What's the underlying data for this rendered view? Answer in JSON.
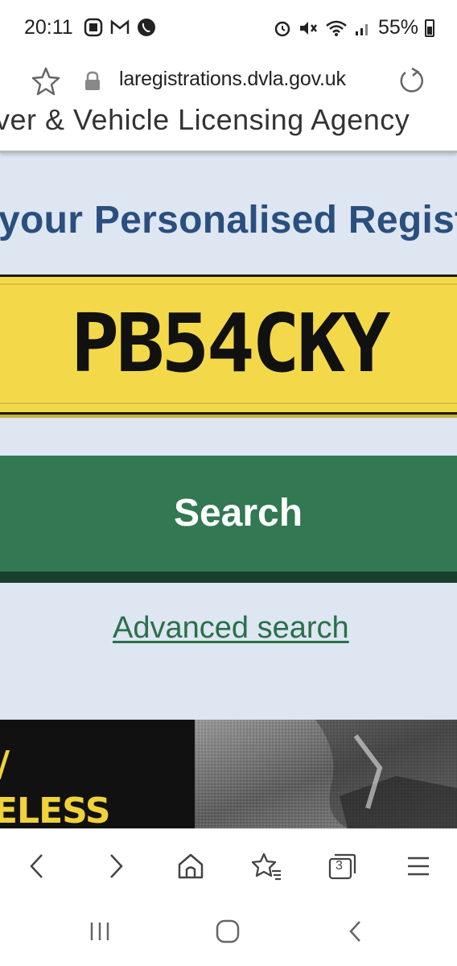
{
  "status_bar": {
    "time": "20:11",
    "battery": "55%",
    "left_icons": [
      "slack-icon",
      "gmail-icon",
      "whatsapp-icon"
    ],
    "right_icons": [
      "alarm-icon",
      "mute-icon",
      "wifi-icon",
      "signal-icon",
      "battery-icon"
    ]
  },
  "browser": {
    "url": "laregistrations.dvla.gov.uk",
    "tab_count": "3"
  },
  "page": {
    "agency_header": "ver & Vehicle Licensing Agency",
    "heading": "your Personalised Regist",
    "plate_value": "PB54CKY",
    "search_label": "Search",
    "advanced_link": "Advanced search",
    "banner_text_top": "/",
    "banner_text_bottom": "ELESS"
  },
  "colors": {
    "heading": "#2a4f7f",
    "plate": "#f3d94a",
    "search_button": "#317853",
    "link": "#2b6f4a",
    "page_bg": "#dde6f1"
  }
}
